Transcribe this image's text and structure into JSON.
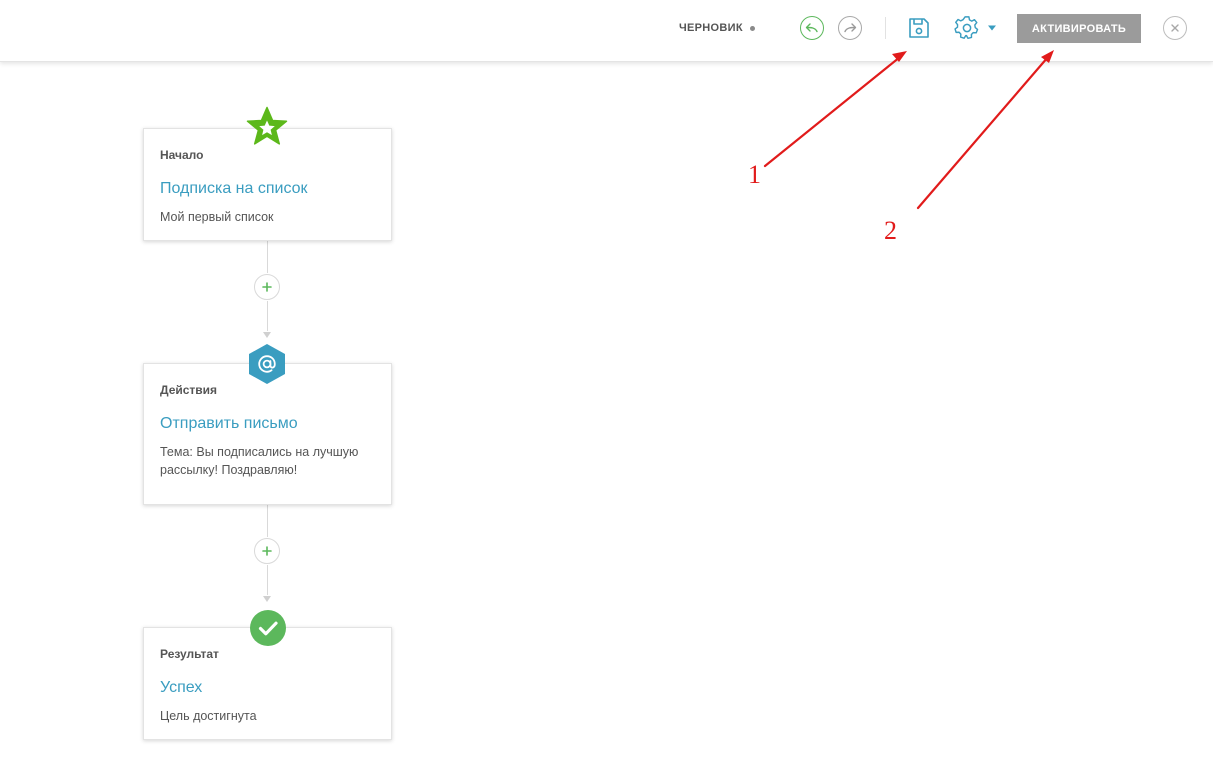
{
  "toolbar": {
    "status_label": "ЧЕРНОВИК",
    "undo_icon": "undo-icon",
    "redo_icon": "redo-icon",
    "save_icon": "floppy-disk-icon",
    "settings_icon": "gear-icon",
    "activate_label": "АКТИВИРОВАТЬ",
    "close_icon": "close-icon"
  },
  "flow": {
    "cards": [
      {
        "label": "Начало",
        "title": "Подписка на список",
        "description": "Мой первый список",
        "badge_icon": "star-icon",
        "badge_color": "#5cb81a"
      },
      {
        "label": "Действия",
        "title": "Отправить письмо",
        "description": "Тема: Вы подписались на лучшую рассылку! Поздравляю!",
        "badge_icon": "at-sign-icon",
        "badge_color": "#3a9dc0"
      },
      {
        "label": "Результат",
        "title": "Успех",
        "description": "Цель достигнута",
        "badge_icon": "checkmark-icon",
        "badge_color": "#5cb85c"
      }
    ],
    "add_step_icon": "plus-icon"
  },
  "annotations": [
    {
      "number": "1"
    },
    {
      "number": "2"
    }
  ],
  "colors": {
    "accent_blue": "#3a9dc0",
    "accent_green": "#5cb85c",
    "annotation_red": "#e11b1b",
    "activate_button": "#9b9b9b"
  }
}
